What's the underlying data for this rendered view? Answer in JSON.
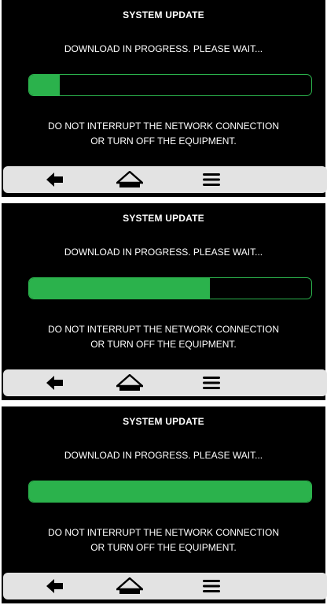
{
  "colors": {
    "screen_background": "#000000",
    "text": "#ffffff",
    "accent_green": "#2bb24c",
    "nav_bar_background": "#e3e3e3",
    "nav_icon": "#000000"
  },
  "screens": [
    {
      "title": "SYSTEM UPDATE",
      "message": "DOWNLOAD IN PROGRESS. PLEASE WAIT...",
      "progress": 0.11,
      "warning_line1": "DO NOT INTERRUPT THE NETWORK CONNECTION",
      "warning_line2": "OR TURN OFF THE EQUIPMENT.",
      "nav": {
        "back_icon": "arrow-left-icon",
        "home_icon": "home-icon",
        "menu_icon": "hamburger-menu-icon"
      }
    },
    {
      "title": "SYSTEM UPDATE",
      "message": "DOWNLOAD IN PROGRESS. PLEASE WAIT...",
      "progress": 0.64,
      "warning_line1": "DO NOT INTERRUPT THE NETWORK CONNECTION",
      "warning_line2": "OR TURN OFF THE EQUIPMENT.",
      "nav": {
        "back_icon": "arrow-left-icon",
        "home_icon": "home-icon",
        "menu_icon": "hamburger-menu-icon"
      }
    },
    {
      "title": "SYSTEM UPDATE",
      "message": "DOWNLOAD IN PROGRESS. PLEASE WAIT...",
      "progress": 1.0,
      "warning_line1": "DO NOT INTERRUPT THE NETWORK CONNECTION",
      "warning_line2": "OR TURN OFF THE EQUIPMENT.",
      "nav": {
        "back_icon": "arrow-left-icon",
        "home_icon": "home-icon",
        "menu_icon": "hamburger-menu-icon"
      }
    }
  ]
}
